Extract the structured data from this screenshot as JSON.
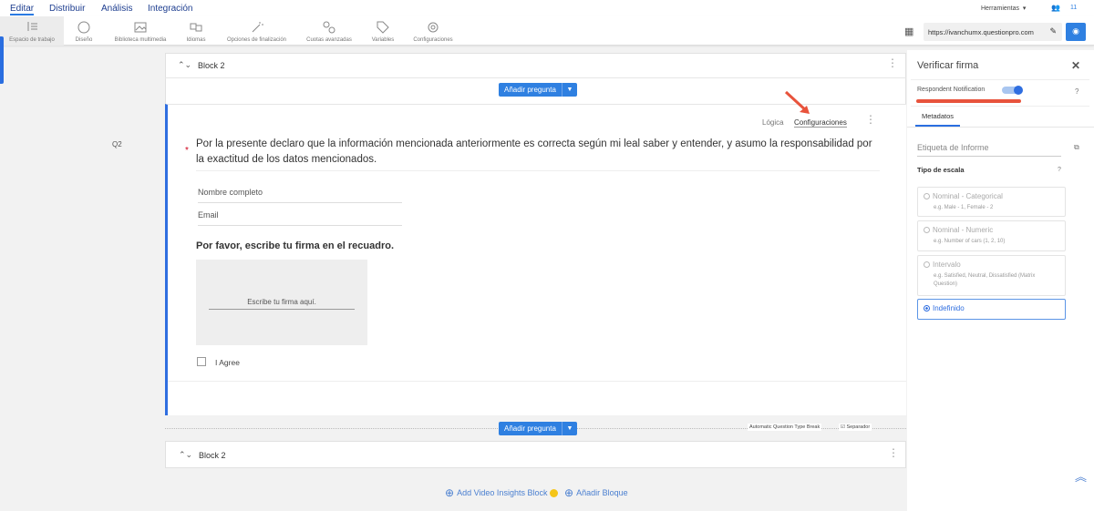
{
  "nav": {
    "tabs": [
      "Editar",
      "Distribuir",
      "Análisis",
      "Integración"
    ],
    "active": "Editar",
    "tools_label": "Herramientas",
    "user_count": "11"
  },
  "toolbar": {
    "items": [
      "Espacio de trabajo",
      "Diseño",
      "Biblioteca multimedia",
      "Idiomas",
      "Opciones de finalización",
      "Cuotas avanzadas",
      "Variables",
      "Configuraciones"
    ],
    "url": "https://ivanchumx.questionpro.com"
  },
  "block1": {
    "title": "Block 2"
  },
  "add_question": "Añadir pregunta",
  "question": {
    "number": "Q2",
    "logic": "Lógica",
    "settings": "Configuraciones",
    "text": "Por la presente declaro que la información mencionada anteriormente es correcta según mi leal saber y entender, y asumo la responsabilidad por la exactitud de los datos mencionados.",
    "field_name": "Nombre completo",
    "field_email": "Email",
    "sign_prompt": "Por favor, escribe tu firma en el recuadro.",
    "sign_placeholder": "Escribe tu firma aquí.",
    "agree": "I Agree"
  },
  "separator": {
    "auto_break": "Automatic Question Type Break",
    "separator": "Separador"
  },
  "block2": {
    "title": "Block 2"
  },
  "footer": {
    "video_block": "Add Video Insights Block",
    "add_block": "Añadir Bloque"
  },
  "panel": {
    "title": "Verificar firma",
    "notification": "Respondent Notification",
    "notification_on": true,
    "tab": "Metadatos",
    "report_label": "Etiqueta de Informe",
    "scale_type": "Tipo de escala",
    "options": [
      {
        "label": "Nominal - Categorical",
        "sub": "e.g. Male - 1, Female - 2"
      },
      {
        "label": "Nominal - Numeric",
        "sub": "e.g. Number of cars (1, 2, 10)"
      },
      {
        "label": "Intervalo",
        "sub": "e.g. Satisfied, Neutral, Dissatisfied (Matrix Question)"
      },
      {
        "label": "Indefinido",
        "sub": "",
        "selected": true
      }
    ]
  },
  "colors": {
    "accent": "#2f80e1",
    "highlight": "#e8533c"
  }
}
